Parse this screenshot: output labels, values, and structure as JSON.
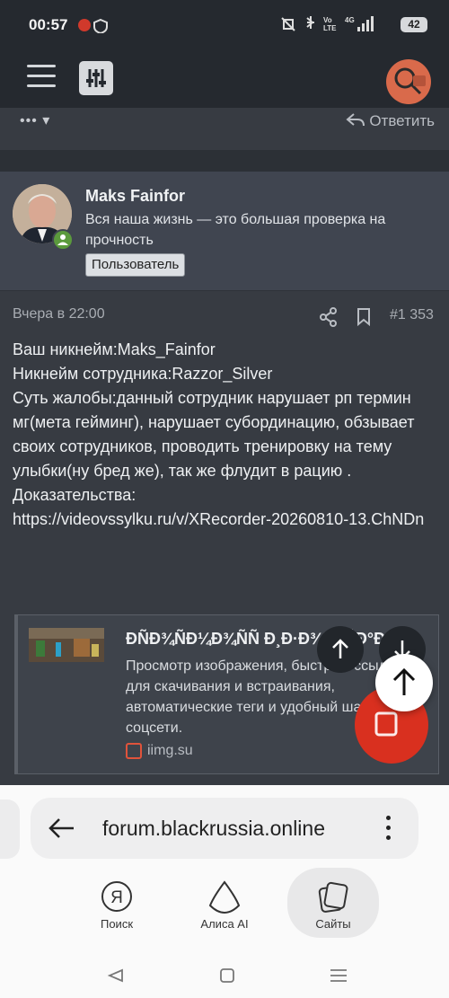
{
  "status": {
    "time": "00:57",
    "battery": "42",
    "network": "4G",
    "volte": "Vo LTE"
  },
  "topbar": {
    "menu": "menu",
    "filter": "filter",
    "search": "search"
  },
  "prev_post": {
    "more": "•••",
    "reply": "Ответить"
  },
  "user": {
    "name": "Maks Fainfor",
    "title": "Вся наша жизнь — это большая проверка на прочность",
    "badge": "Пользователь"
  },
  "post": {
    "date": "Вчера в 22:00",
    "number": "#1 353",
    "lines": [
      "Ваш никнейм:Maks_Fainfor",
      "Никнейм сотрудника:Razzor_Silver",
      "Суть жалобы:данный сотрудник нарушает рп термин мг(мета гейминг), нарушает субординацию, обзывает своих сотрудников, проводить тренировку на тему улыбки(ну бред же), так же флудит в рацию .",
      "Доказательства:",
      "https://videovssylku.ru/v/XRecorder-20260810-13.ChNDn"
    ]
  },
  "link_card": {
    "title": "ÐÑÐ¾ÑÐ¼Ð¾ÑÑ Ð¸Ð·Ð¾Ð±ÑÐ°Ð¶",
    "description": "Просмотр изображения, быстрые ссылки для скачивания и встраивания, автоматические теги и удобный шаринг в соцсети.",
    "domain": "iimg.su"
  },
  "browser": {
    "url": "forum.blackrussia.online",
    "nav": [
      {
        "label": "Поиск"
      },
      {
        "label": "Алиса AI"
      },
      {
        "label": "Сайты"
      }
    ]
  },
  "colors": {
    "accent_red": "#d9301f",
    "online": "#5b9a3d"
  }
}
